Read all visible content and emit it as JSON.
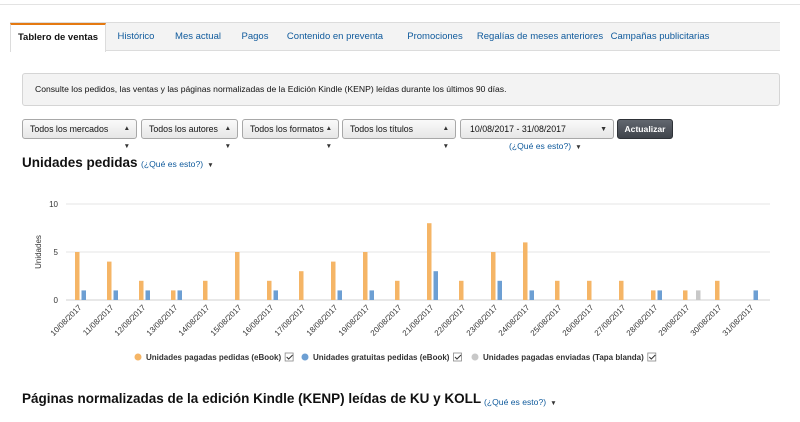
{
  "tabs": [
    {
      "label": "Tablero de ventas",
      "active": true
    },
    {
      "label": "Histórico",
      "active": false
    },
    {
      "label": "Mes actual",
      "active": false
    },
    {
      "label": "Pagos",
      "active": false
    },
    {
      "label": "Contenido en preventa",
      "active": false
    },
    {
      "label": "Promociones",
      "active": false
    },
    {
      "label": "Regalías de meses anteriores",
      "active": false
    },
    {
      "label": "Campañas publicitarias",
      "active": false
    }
  ],
  "info_text": "Consulte los pedidos, las ventas y las páginas normalizadas de la Edición Kindle (KENP) leídas durante los últimos 90 días.",
  "filters": {
    "markets": "Todos los mercados",
    "authors": "Todos los autores",
    "formats": "Todos los formatos",
    "titles": "Todos los títulos",
    "date_range": "10/08/2017 - 31/08/2017",
    "update_label": "Actualizar",
    "help_link": "(¿Qué es esto?)"
  },
  "section_units": {
    "title": "Unidades pedidas",
    "help_link": "(¿Qué es esto?)"
  },
  "section_kenp": {
    "title": "Páginas normalizadas de la edición Kindle (KENP) leídas de KU y KOLL",
    "help_link": "(¿Qué es esto?)"
  },
  "colors": {
    "paid_ebook": "#f5b566",
    "free_ebook": "#6d9fd3",
    "paperback": "#c8c8c8",
    "accent": "#e47911",
    "link": "#0f5a9c"
  },
  "chart_data": {
    "type": "bar",
    "ylabel": "Unidades",
    "ylim": [
      0,
      10
    ],
    "yticks": [
      0,
      5,
      10
    ],
    "categories": [
      "10/08/2017",
      "11/08/2017",
      "12/08/2017",
      "13/08/2017",
      "14/08/2017",
      "15/08/2017",
      "16/08/2017",
      "17/08/2017",
      "18/08/2017",
      "19/08/2017",
      "20/08/2017",
      "21/08/2017",
      "22/08/2017",
      "23/08/2017",
      "24/08/2017",
      "25/08/2017",
      "26/08/2017",
      "27/08/2017",
      "28/08/2017",
      "29/08/2017",
      "30/08/2017",
      "31/08/2017"
    ],
    "series": [
      {
        "name": "Unidades pagadas pedidas (eBook)",
        "color": "#f5b566",
        "values": [
          5,
          4,
          2,
          1,
          2,
          5,
          2,
          3,
          4,
          5,
          2,
          8,
          2,
          5,
          6,
          2,
          2,
          2,
          1,
          1,
          2,
          0
        ]
      },
      {
        "name": "Unidades gratuitas pedidas (eBook)",
        "color": "#6d9fd3",
        "values": [
          1,
          1,
          1,
          1,
          0,
          0,
          1,
          0,
          1,
          1,
          0,
          3,
          0,
          2,
          1,
          0,
          0,
          0,
          1,
          0,
          0,
          1
        ]
      },
      {
        "name": "Unidades pagadas enviadas (Tapa blanda)",
        "color": "#c8c8c8",
        "values": [
          0,
          0,
          0,
          0,
          0,
          0,
          0,
          0,
          0,
          0,
          0,
          0,
          0,
          0,
          0,
          0,
          0,
          0,
          0,
          1,
          0,
          0
        ]
      }
    ],
    "grid": true,
    "legend": "bottom"
  }
}
